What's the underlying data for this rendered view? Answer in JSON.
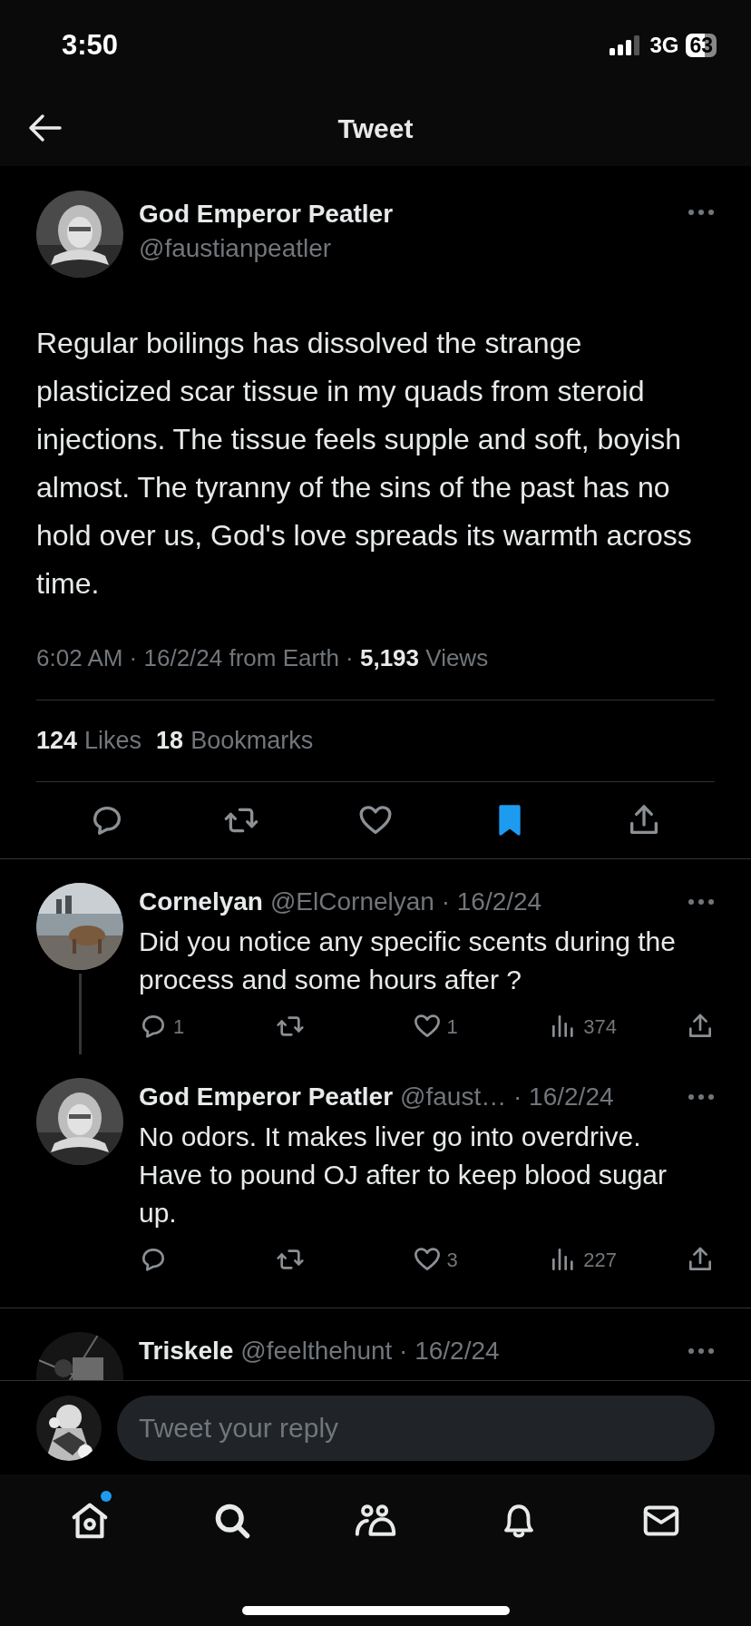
{
  "status_bar": {
    "time": "3:50",
    "network": "3G",
    "battery": "63"
  },
  "header": {
    "title": "Tweet"
  },
  "tweet": {
    "author": "God Emperor Peatler",
    "handle": "@faustianpeatler",
    "text": "Regular boilings has dissolved the strange plasticized scar tissue in my quads from steroid injections. The tissue feels supple and soft, boyish almost. The tyranny of the sins of the past has no hold over us, God's love spreads its warmth across time.",
    "meta": "6:02 AM · 16/2/24 from Earth · **5,193** Views",
    "stats": [
      {
        "count": "124",
        "label": "Likes"
      },
      {
        "count": "18",
        "label": "Bookmarks"
      }
    ],
    "actions": [
      {
        "kind": "reply",
        "on": false
      },
      {
        "kind": "retweet",
        "on": false
      },
      {
        "kind": "like",
        "on": false
      },
      {
        "kind": "bookmark",
        "on": true
      },
      {
        "kind": "share",
        "on": false
      }
    ]
  },
  "replies": [
    {
      "name": "Cornelyan",
      "meta": "@ElCornelyan · 16/2/24",
      "text": "Did you notice any specific scents during the process and some hours after ?",
      "thread_line": true,
      "actions": [
        {
          "kind": "reply",
          "count": "1"
        },
        {
          "kind": "retweet"
        },
        {
          "kind": "like",
          "count": "1"
        },
        {
          "kind": "views",
          "count": "374"
        },
        {
          "kind": "share"
        }
      ]
    },
    {
      "name": "God Emperor Peatler",
      "meta": "@faust… · 16/2/24",
      "text": "No odors. It makes liver go into overdrive. Have to pound OJ after to keep blood sugar up.",
      "thread_line": false,
      "actions": [
        {
          "kind": "reply"
        },
        {
          "kind": "retweet"
        },
        {
          "kind": "like",
          "count": "3"
        },
        {
          "kind": "views",
          "count": "227"
        },
        {
          "kind": "share"
        }
      ]
    },
    {
      "name": "Triskele",
      "meta": "@feelthehunt · 16/2/24",
      "thread_line": false
    }
  ],
  "reply_bar": {
    "placeholder": "Tweet your reply"
  },
  "tab_bar": [
    {
      "kind": "home",
      "dot": true
    },
    {
      "kind": "search",
      "dot": false
    },
    {
      "kind": "communities",
      "dot": false
    },
    {
      "kind": "notifications",
      "dot": false
    },
    {
      "kind": "messages",
      "dot": false
    }
  ]
}
